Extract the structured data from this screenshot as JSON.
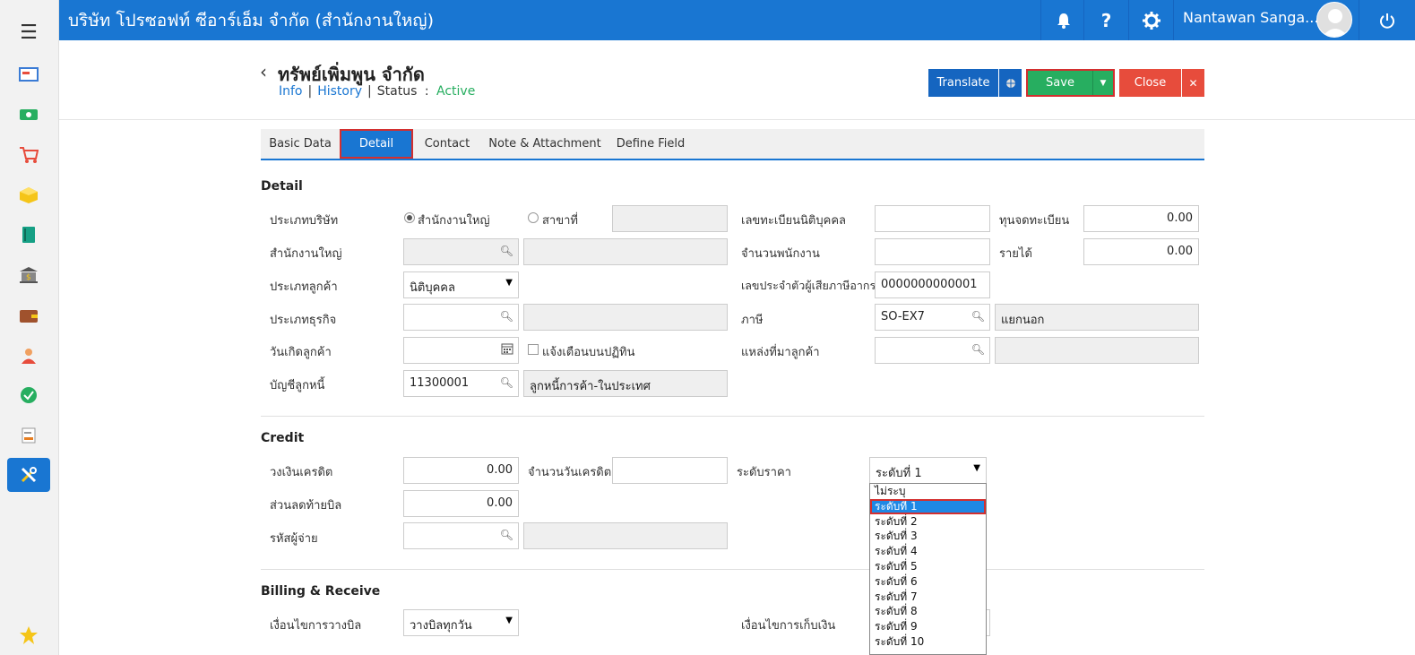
{
  "topbar": {
    "company": "บริษัท โปรซอฟท์ ซีอาร์เอ็ม จำกัด (สำนักงานใหญ่)",
    "user": "Nantawan Sanga..."
  },
  "header": {
    "title": "ทรัพย์เพิ่มพูน จำกัด",
    "link_info": "Info",
    "link_history": "History",
    "status_label": "Status",
    "status_colon": ":",
    "status_value": "Active",
    "translate": "Translate",
    "save": "Save",
    "close": "Close"
  },
  "tabs": [
    "Basic Data",
    "Detail",
    "Contact",
    "Note & Attachment",
    "Define Field"
  ],
  "detail": {
    "section": "Detail",
    "company_type_label": "ประเภทบริษัท",
    "radio_hq": "สำนักงานใหญ่",
    "radio_branch": "สาขาที่",
    "hq_label": "สำนักงานใหญ่",
    "customer_type_label": "ประเภทลูกค้า",
    "customer_type_value": "นิติบุคคล",
    "business_type_label": "ประเภทธุรกิจ",
    "birthday_label": "วันเกิดลูกค้า",
    "calendar_notify": "แจ้งเตือนบนปฏิทิน",
    "ar_account_label": "บัญชีลูกหนี้",
    "ar_account_code": "11300001",
    "ar_account_name": "ลูกหนี้การค้า-ในประเทศ",
    "reg_no_label": "เลขทะเบียนนิติบุคคล",
    "employees_label": "จำนวนพนักงาน",
    "tax_id_label": "เลขประจำตัวผู้เสียภาษีอากร",
    "tax_id_value": "0000000000001",
    "tax_label": "ภาษี",
    "tax_code": "SO-EX7",
    "tax_name": "แยกนอก",
    "source_label": "แหล่งที่มาลูกค้า",
    "capital_label": "ทุนจดทะเบียน",
    "capital_value": "0.00",
    "income_label": "รายได้",
    "income_value": "0.00"
  },
  "credit": {
    "section": "Credit",
    "limit_label": "วงเงินเครดิต",
    "limit_value": "0.00",
    "days_label": "จำนวนวันเครดิต",
    "price_level_label": "ระดับราคา",
    "price_level_value": "ระดับที่ 1",
    "discount_label": "ส่วนลดท้ายบิล",
    "discount_value": "0.00",
    "seller_label": "รหัสผู้จ่าย"
  },
  "price_level_options": [
    "ไม่ระบุ",
    "ระดับที่ 1",
    "ระดับที่ 2",
    "ระดับที่ 3",
    "ระดับที่ 4",
    "ระดับที่ 5",
    "ระดับที่ 6",
    "ระดับที่ 7",
    "ระดับที่ 8",
    "ระดับที่ 9",
    "ระดับที่ 10"
  ],
  "price_level_selected_index": 1,
  "billing": {
    "section": "Billing & Receive",
    "billing_cond_label": "เงื่อนไขการวางบิล",
    "billing_cond_value": "วางบิลทุกวัน",
    "collect_cond_label": "เงื่อนไขการเก็บเงิน"
  },
  "colors": {
    "primary": "#1976d2",
    "save": "#27ae60",
    "close": "#e74c3c",
    "highlight": "#d32f2f"
  }
}
